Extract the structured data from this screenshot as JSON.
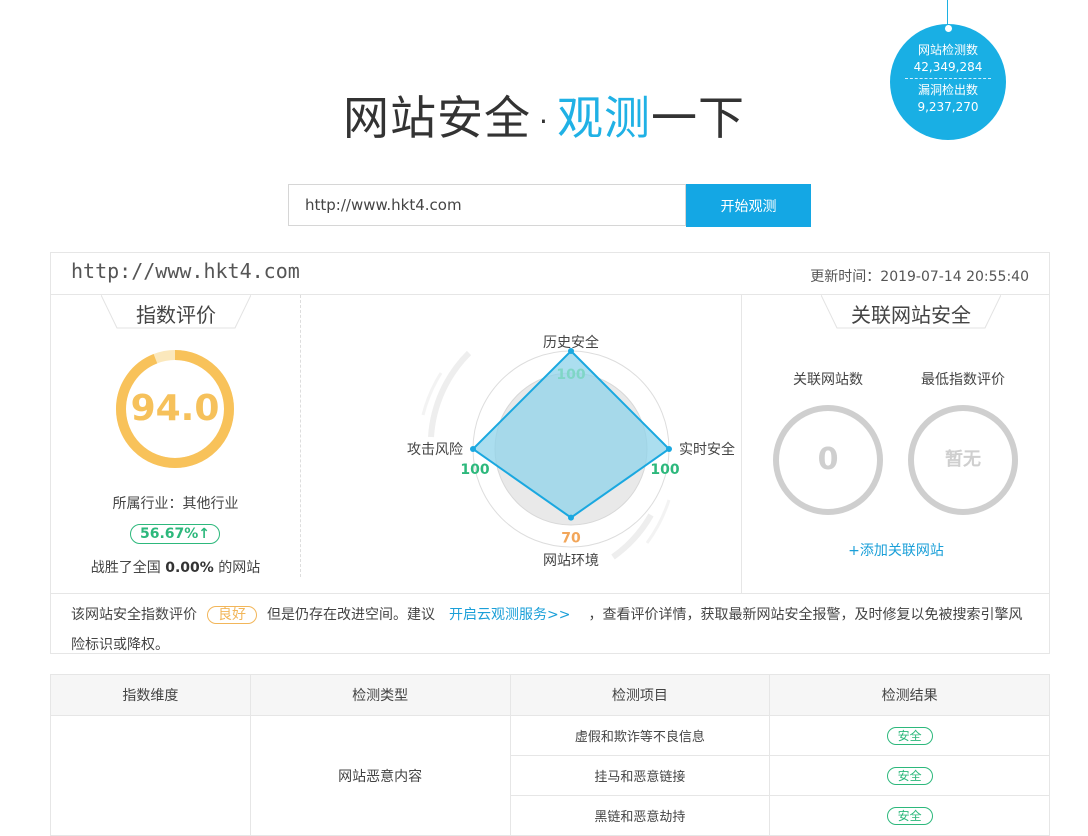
{
  "stats": {
    "scanned_label": "网站检测数",
    "scanned_value": "42,349,284",
    "vuln_label": "漏洞检出数",
    "vuln_value": "9,237,270"
  },
  "hero": {
    "title_part1": "网站安全",
    "title_dot": "·",
    "title_accent": "观测",
    "title_part2": "一下"
  },
  "search": {
    "value": "http://www.hkt4.com",
    "button_label": "开始观测"
  },
  "report": {
    "url": "http://www.hkt4.com",
    "update_time": "更新时间：2019-07-14 20:55:40",
    "index_section": {
      "title": "指数评价",
      "score": "94.0",
      "score_fraction": 0.94,
      "industry": "所属行业：其他行业",
      "percent_badge": "56.67%↑",
      "beat_prefix": "战胜了全国 ",
      "beat_value": "0.00%",
      "beat_suffix": " 的网站"
    },
    "radar": {
      "axes": [
        {
          "label": "历史安全",
          "value": 100,
          "color": "#7fd6c6"
        },
        {
          "label": "实时安全",
          "value": 100,
          "color": "#2db87c"
        },
        {
          "label": "网站环境",
          "value": 70,
          "color": "#f2a65a"
        },
        {
          "label": "攻击风险",
          "value": 100,
          "color": "#2db87c"
        }
      ],
      "max": 100,
      "fill_color": "#8fd3ea",
      "stroke_color": "#1aa8e0"
    },
    "assoc_section": {
      "title": "关联网站安全",
      "count_label": "关联网站数",
      "count_value": "0",
      "lowest_label": "最低指数评价",
      "lowest_value": "暂无",
      "add_link": "+添加关联网站"
    },
    "advice": {
      "prefix": "该网站安全指数评价",
      "grade": "良好",
      "middle": "但是仍存在改进空间。建议",
      "link": "开启云观测服务>>",
      "suffix": "，查看评价详情，获取最新网站安全报警，及时修复以免被搜索引擎风险标识或降权。"
    }
  },
  "table": {
    "headers": [
      "指数维度",
      "检测类型",
      "检测项目",
      "检测结果"
    ],
    "dimension": "",
    "type": "网站恶意内容",
    "rows": [
      {
        "item": "虚假和欺诈等不良信息",
        "result": "安全"
      },
      {
        "item": "挂马和恶意链接",
        "result": "安全"
      },
      {
        "item": "黑链和恶意劫持",
        "result": "安全"
      }
    ]
  }
}
